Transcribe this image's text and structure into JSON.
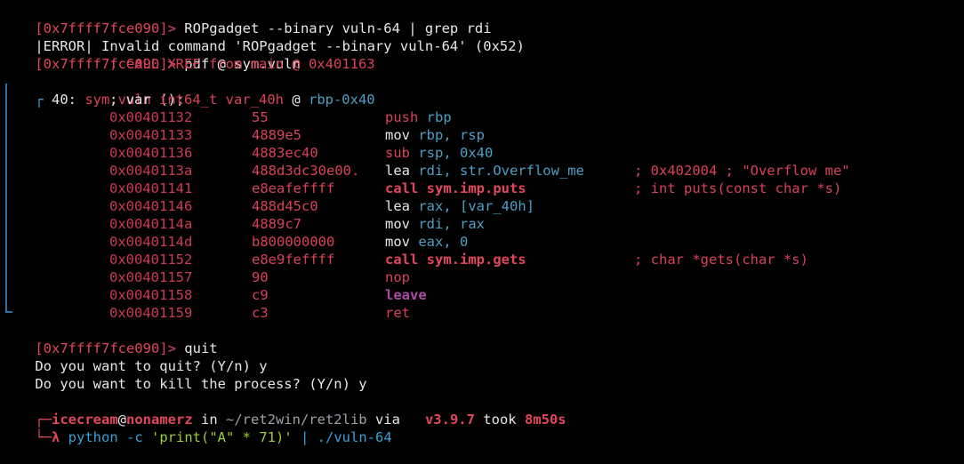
{
  "terminal": {
    "lines": {
      "l1": {
        "prompt": "[0x7ffff7fce090]>",
        "cmd": " ROPgadget --binary vuln-64 | grep rdi"
      },
      "l2": {
        "text": "|ERROR| Invalid command 'ROPgadget --binary vuln-64' (0x52)"
      },
      "l3": {
        "prompt": "[0x7ffff7fce090]>",
        "cmd": " pdf @ sym.vuln"
      },
      "l4": {
        "text": "; CALL XREF from main @ 0x401163"
      },
      "l5": {
        "corner": "┌",
        "size": " 40: ",
        "fn": "sym.vuln",
        "rest": " ();"
      },
      "l6": {
        "pre": "; var ",
        "type": "int64_t var_40h",
        "at": " @ ",
        "reg": "rbp-0x40"
      },
      "q1": {
        "prompt": "[0x7ffff7fce090]>",
        "cmd": " quit"
      },
      "q2": {
        "text": "Do you want to quit? (Y/n) y"
      },
      "q3": {
        "text": "Do you want to kill the process? (Y/n) y"
      },
      "p1": {
        "corner": "┌─",
        "user": "icecream",
        "at": "@",
        "host": "nonamerz",
        "in": " in ",
        "path": "~/ret2win/ret2lib",
        "via": " via ",
        "ver": "  v3.9.7",
        "took": " took ",
        "dur": "8m50s"
      },
      "p2": {
        "corner": "└─",
        "lambda": "λ",
        "cmd": " python",
        "flag": " -c",
        "str": " 'print(\"A\" * 71)'",
        "pipe": " |",
        "target": " ./vuln-64"
      }
    },
    "asm": [
      {
        "addr": "0x00401132",
        "bytes": "55",
        "op": "push",
        "args": " rbp",
        "comment": ""
      },
      {
        "addr": "0x00401133",
        "bytes": "4889e5",
        "op": "mov",
        "args": " rbp, rsp",
        "comment": ""
      },
      {
        "addr": "0x00401136",
        "bytes": "4883ec40",
        "op": "sub",
        "args": " rsp, 0x40",
        "comment": ""
      },
      {
        "addr": "0x0040113a",
        "bytes": "488d3dc30e00.",
        "op": "lea",
        "args": " rdi, str.Overflow_me",
        "comment": "; 0x402004 ; \"Overflow me\""
      },
      {
        "addr": "0x00401141",
        "bytes": "e8eafeffff",
        "op": "call sym.imp.puts",
        "args": "",
        "comment": "; int puts(const char *s)"
      },
      {
        "addr": "0x00401146",
        "bytes": "488d45c0",
        "op": "lea",
        "args": " rax, [var_40h]",
        "comment": ""
      },
      {
        "addr": "0x0040114a",
        "bytes": "4889c7",
        "op": "mov",
        "args": " rdi, rax",
        "comment": ""
      },
      {
        "addr": "0x0040114d",
        "bytes": "b800000000",
        "op": "mov",
        "args": " eax, 0",
        "comment": ""
      },
      {
        "addr": "0x00401152",
        "bytes": "e8e9feffff",
        "op": "call sym.imp.gets",
        "args": "",
        "comment": "; char *gets(char *s)"
      },
      {
        "addr": "0x00401157",
        "bytes": "90",
        "op": "nop",
        "args": "",
        "comment": ""
      },
      {
        "addr": "0x00401158",
        "bytes": "c9",
        "op": "leave",
        "args": "",
        "comment": ""
      },
      {
        "addr": "0x00401159",
        "bytes": "c3",
        "op": "ret",
        "args": "",
        "comment": ""
      }
    ],
    "colors": {
      "background": "#000000",
      "prompt": "#e0475d",
      "register": "#4d9fc4",
      "leave": "#b04aa8",
      "version": "#e0475d"
    }
  }
}
